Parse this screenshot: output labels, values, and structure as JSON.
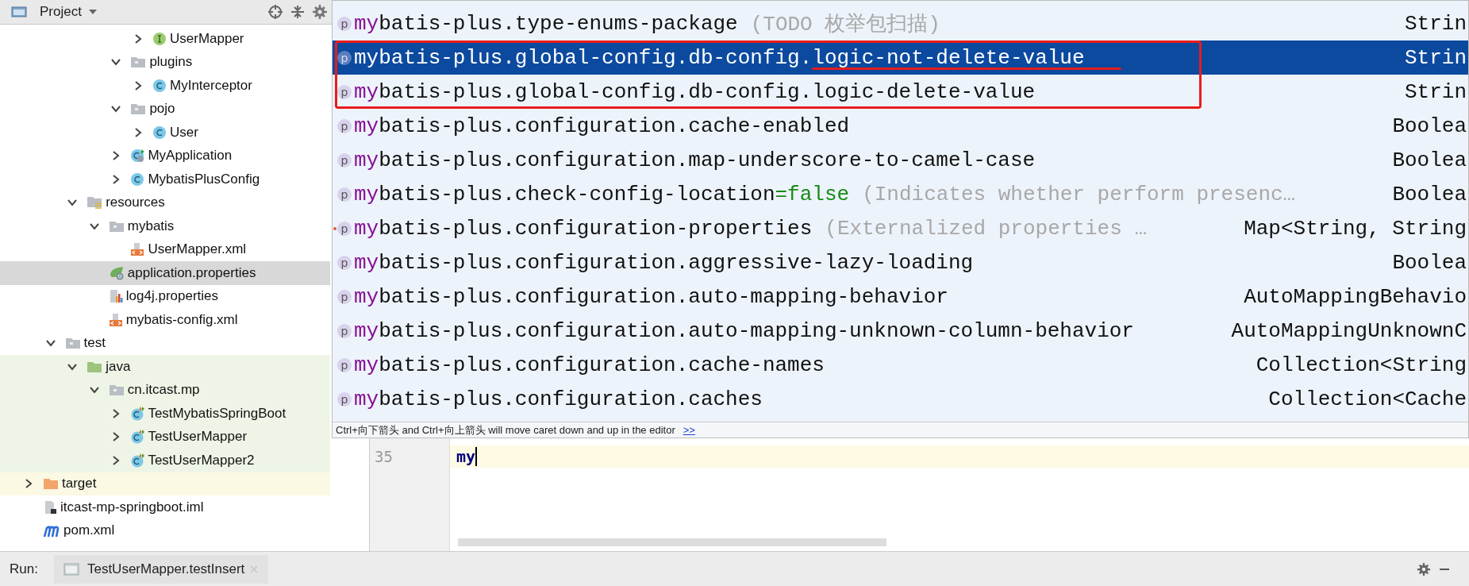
{
  "project_panel": {
    "title": "Project",
    "tree": [
      {
        "children": [
          {
            "children": [
              {
                "children": [
                  {
                    "children": [
                      {
                        "children": [
                          {
                            "label": "UserMapper",
                            "kind": "interface",
                            "expanded": false,
                            "selected": false
                          }
                        ]
                      },
                      {
                        "label": "plugins",
                        "kind": "folder",
                        "expanded": true,
                        "selected": false,
                        "children": [
                          {
                            "label": "MyInterceptor",
                            "kind": "class",
                            "expanded": false,
                            "selected": false
                          }
                        ]
                      },
                      {
                        "label": "pojo",
                        "kind": "folder",
                        "expanded": true,
                        "selected": false,
                        "children": [
                          {
                            "label": "User",
                            "kind": "class",
                            "expanded": false,
                            "selected": false
                          }
                        ]
                      },
                      {
                        "label": "MyApplication",
                        "kind": "app-class",
                        "expanded": false,
                        "selected": false
                      },
                      {
                        "label": "MybatisPlusConfig",
                        "kind": "class",
                        "expanded": false,
                        "selected": false
                      }
                    ]
                  }
                ]
              },
              {
                "label": "resources",
                "kind": "resources-folder",
                "expanded": true,
                "selected": false,
                "children": [
                  {
                    "label": "mybatis",
                    "kind": "folder",
                    "expanded": true,
                    "selected": false,
                    "children": [
                      {
                        "label": "UserMapper.xml",
                        "kind": "xml",
                        "selected": false
                      }
                    ]
                  },
                  {
                    "label": "application.properties",
                    "kind": "spring-properties",
                    "selected": true
                  },
                  {
                    "label": "log4j.properties",
                    "kind": "log-properties",
                    "selected": false
                  },
                  {
                    "label": "mybatis-config.xml",
                    "kind": "xml",
                    "selected": false
                  }
                ]
              }
            ]
          },
          {
            "label": "test",
            "kind": "folder",
            "expanded": true,
            "selected": false,
            "children": [
              {
                "label": "java",
                "kind": "test-folder",
                "expanded": true,
                "selected": false,
                "children": [
                  {
                    "label": "cn.itcast.mp",
                    "kind": "folder",
                    "expanded": true,
                    "selected": false,
                    "children": [
                      {
                        "label": "TestMybatisSpringBoot",
                        "kind": "test-class",
                        "expanded": false,
                        "selected": false
                      },
                      {
                        "label": "TestUserMapper",
                        "kind": "test-class",
                        "expanded": false,
                        "selected": false
                      },
                      {
                        "label": "TestUserMapper2",
                        "kind": "test-class",
                        "expanded": false,
                        "selected": false
                      }
                    ]
                  }
                ]
              }
            ]
          }
        ]
      },
      {
        "label": "target",
        "kind": "excluded-folder",
        "expanded": false,
        "selected": false
      },
      {
        "label": "itcast-mp-springboot.iml",
        "kind": "iml",
        "selected": false
      },
      {
        "label": "pom.xml",
        "kind": "maven",
        "selected": false
      }
    ]
  },
  "editor": {
    "line_number": "35",
    "text": "my"
  },
  "popup": {
    "rows": [
      {
        "icon": "p",
        "name": "mybatis-plus.type-enums-package",
        "hint": "(TODO 枚举包扫描)",
        "type": "Strin",
        "selected": false,
        "annotated": false,
        "underlined": false,
        "flagged": false
      },
      {
        "icon": "p",
        "name": "mybatis-plus.global-config.db-config.logic-not-delete-value",
        "type": "Strin",
        "selected": true,
        "annotated": true,
        "underlined": true,
        "flagged": false
      },
      {
        "icon": "p",
        "name": "mybatis-plus.global-config.db-config.logic-delete-value",
        "type": "Strin",
        "selected": false,
        "annotated": true,
        "underlined": false,
        "flagged": false
      },
      {
        "icon": "p",
        "name": "mybatis-plus.configuration.cache-enabled",
        "type": "Boolea",
        "selected": false,
        "annotated": false,
        "underlined": false,
        "flagged": false
      },
      {
        "icon": "p",
        "name": "mybatis-plus.configuration.map-underscore-to-camel-case",
        "type": "Boolea",
        "selected": false,
        "annotated": false,
        "underlined": false,
        "flagged": false
      },
      {
        "icon": "p",
        "name": "mybatis-plus.check-config-location",
        "value": "=false",
        "hint": "(Indicates whether perform presenc…",
        "type": "Boolea",
        "selected": false,
        "annotated": false,
        "underlined": false,
        "flagged": false
      },
      {
        "icon": "p",
        "name": "mybatis-plus.configuration-properties",
        "hint": "(Externalized properties …",
        "type": "Map<String, String",
        "selected": false,
        "annotated": false,
        "underlined": false,
        "flagged": true
      },
      {
        "icon": "p",
        "name": "mybatis-plus.configuration.aggressive-lazy-loading",
        "type": "Boolea",
        "selected": false,
        "annotated": false,
        "underlined": false,
        "flagged": false
      },
      {
        "icon": "p",
        "name": "mybatis-plus.configuration.auto-mapping-behavior",
        "type": "AutoMappingBehavio",
        "selected": false,
        "annotated": false,
        "underlined": false,
        "flagged": false
      },
      {
        "icon": "p",
        "name": "mybatis-plus.configuration.auto-mapping-unknown-column-behavior",
        "type": "AutoMappingUnknownC",
        "selected": false,
        "annotated": false,
        "underlined": false,
        "flagged": false
      },
      {
        "icon": "p",
        "name": "mybatis-plus.configuration.cache-names",
        "type": "Collection<String",
        "selected": false,
        "annotated": false,
        "underlined": false,
        "flagged": false
      },
      {
        "icon": "p",
        "name": "mybatis-plus.configuration.caches",
        "type": "Collection<Cache",
        "selected": false,
        "annotated": false,
        "underlined": false,
        "flagged": false
      }
    ],
    "footer": {
      "text": "Ctrl+向下箭头 and Ctrl+向上箭头 will move caret down and up in the editor",
      "link": ">>"
    }
  },
  "run_bar": {
    "label": "Run:",
    "tab": "TestUserMapper.testInsert"
  }
}
